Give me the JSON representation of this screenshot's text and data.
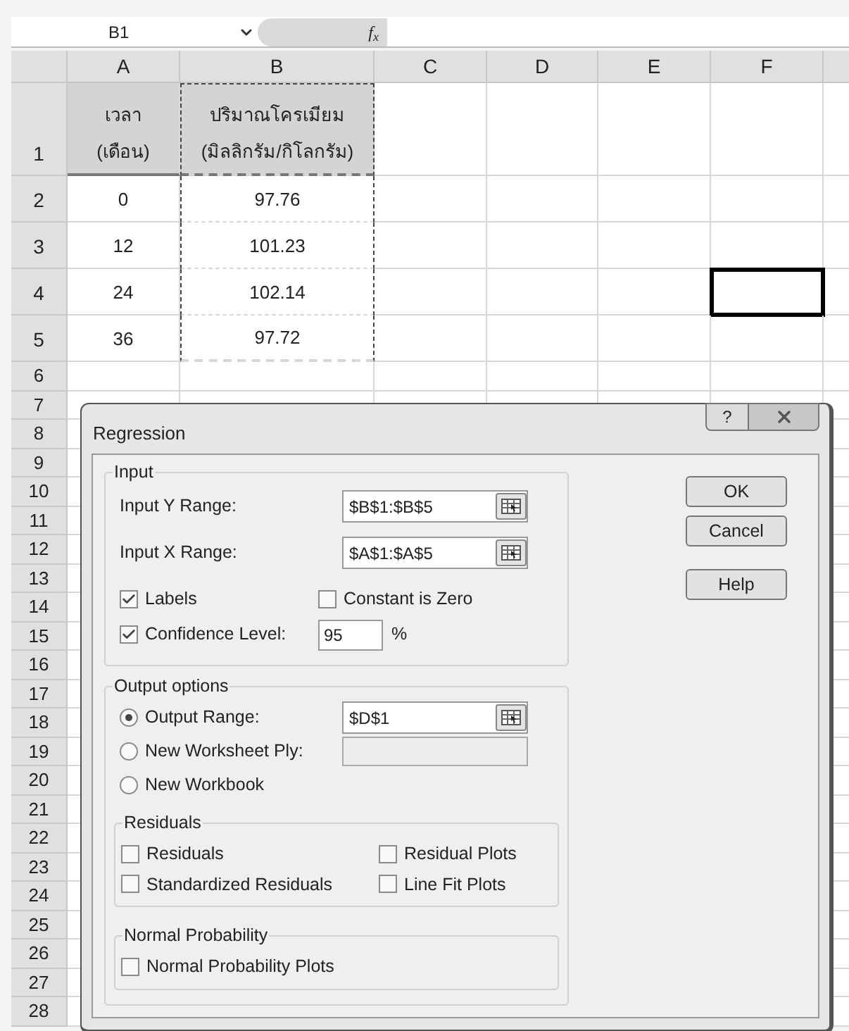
{
  "formula_bar": {
    "name_box": "B1",
    "function_label": "f$_{x}$"
  },
  "column_headers": [
    "A",
    "B",
    "C",
    "D",
    "E",
    "F"
  ],
  "rows": [
    {
      "number": "1",
      "cells": [
        {
          "text": "เวลา\n(เดือน)",
          "shaded": true,
          "marquee": false,
          "selected": false
        },
        {
          "text": "ปริมาณโครเมียม\n(มิลลิกรัม/กิโลกรัม)",
          "shaded": true,
          "marquee": true,
          "selected": false
        },
        {
          "selected": false,
          "marquee": false,
          "shaded": false
        },
        {
          "selected": false,
          "marquee": false,
          "shaded": false
        },
        {
          "selected": false,
          "marquee": false,
          "shaded": false
        },
        {
          "selected": false,
          "marquee": false,
          "shaded": false
        }
      ]
    },
    {
      "number": "2",
      "cells": [
        {
          "text": "0",
          "shaded": false,
          "marquee": false,
          "selected": false
        },
        {
          "text": "97.76",
          "shaded": false,
          "marquee": true,
          "selected": false
        },
        {
          "selected": false,
          "marquee": false,
          "shaded": false
        },
        {
          "selected": false,
          "marquee": false,
          "shaded": false
        },
        {
          "selected": false,
          "marquee": false,
          "shaded": false
        },
        {
          "selected": false,
          "marquee": false,
          "shaded": false
        }
      ]
    },
    {
      "number": "3",
      "cells": [
        {
          "text": "12",
          "shaded": false,
          "marquee": false,
          "selected": false
        },
        {
          "text": "101.23",
          "shaded": false,
          "marquee": true,
          "selected": false
        },
        {
          "selected": false,
          "marquee": false,
          "shaded": false
        },
        {
          "selected": false,
          "marquee": false,
          "shaded": false
        },
        {
          "selected": false,
          "marquee": false,
          "shaded": false
        },
        {
          "selected": false,
          "marquee": false,
          "shaded": false
        }
      ]
    },
    {
      "number": "4",
      "cells": [
        {
          "text": "24",
          "shaded": false,
          "marquee": false,
          "selected": false
        },
        {
          "text": "102.14",
          "shaded": false,
          "marquee": true,
          "selected": false
        },
        {
          "selected": false,
          "marquee": false,
          "shaded": false
        },
        {
          "selected": false,
          "marquee": false,
          "shaded": false
        },
        {
          "selected": false,
          "marquee": false,
          "shaded": false
        },
        {
          "selected": true,
          "marquee": false,
          "shaded": false
        }
      ]
    },
    {
      "number": "5",
      "cells": [
        {
          "text": "36",
          "shaded": false,
          "marquee": false,
          "selected": false
        },
        {
          "text": "97.72",
          "shaded": false,
          "marquee": true,
          "selected": false
        },
        {
          "selected": false,
          "marquee": false,
          "shaded": false
        },
        {
          "selected": false,
          "marquee": false,
          "shaded": false
        },
        {
          "selected": false,
          "marquee": false,
          "shaded": false
        },
        {
          "selected": false,
          "marquee": false,
          "shaded": false
        }
      ]
    }
  ],
  "empty_row_numbers": [
    "6",
    "7",
    "8",
    "9",
    "10",
    "11",
    "12",
    "13",
    "14",
    "15",
    "16",
    "17",
    "18",
    "19",
    "20",
    "21",
    "22",
    "23",
    "24",
    "25",
    "26",
    "27",
    "28"
  ],
  "dialog": {
    "title": "Regression",
    "help_glyph": "?",
    "input_group": {
      "title": "Input",
      "ranges": [
        {
          "label": "Input Y Range:",
          "value": "$B$1:$B$5"
        },
        {
          "label": "Input X Range:",
          "value": "$A$1:$A$5"
        }
      ],
      "options": [
        {
          "label": "Labels",
          "checked": true
        },
        {
          "label": "Constant is Zero",
          "checked": false
        },
        {
          "label": "Confidence Level:",
          "checked": true
        }
      ],
      "confidence": {
        "value": "95",
        "unit": "%"
      }
    },
    "output_group": {
      "title": "Output options",
      "destinations": [
        {
          "label": "Output Range:",
          "selected": true,
          "kind": "range",
          "value": "$D$1"
        },
        {
          "label": "New Worksheet Ply:",
          "selected": false,
          "kind": "text"
        },
        {
          "label": "New Workbook",
          "selected": false,
          "kind": "plain"
        }
      ],
      "residuals": {
        "title": "Residuals",
        "options": [
          {
            "label": "Residuals",
            "checked": false
          },
          {
            "label": "Residual Plots",
            "checked": false
          },
          {
            "label": "Standardized Residuals",
            "checked": false
          },
          {
            "label": "Line Fit Plots",
            "checked": false
          }
        ]
      },
      "normal_probability": {
        "title": "Normal Probability",
        "options": [
          {
            "label": "Normal Probability Plots",
            "checked": false
          }
        ]
      }
    },
    "buttons": [
      {
        "label": "OK"
      },
      {
        "label": "Cancel"
      },
      {
        "label": "Help"
      }
    ]
  }
}
